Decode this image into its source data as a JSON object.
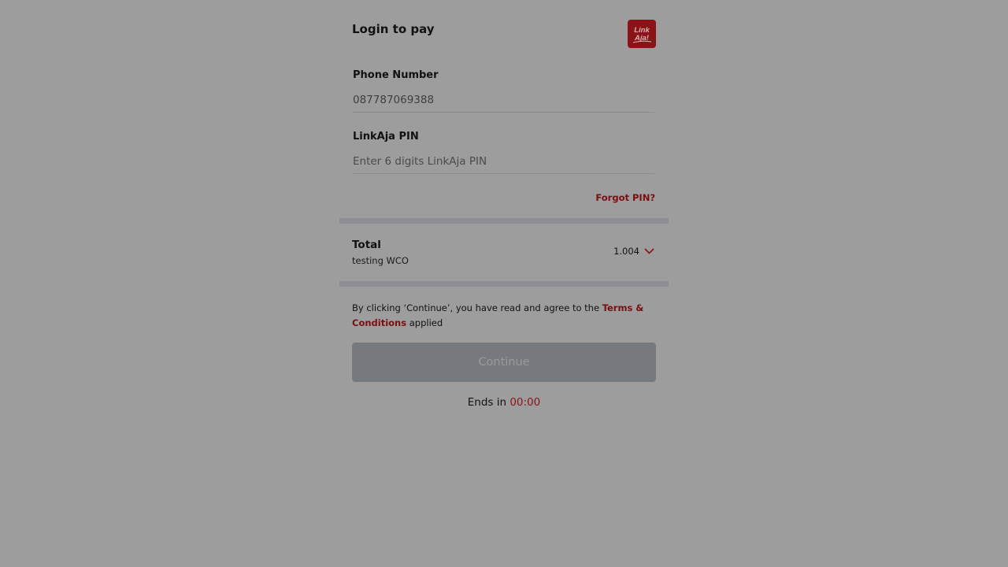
{
  "header": {
    "title": "Login to pay",
    "logo_text": "LinkAja!",
    "brand_color": "#8b1216"
  },
  "phone": {
    "label": "Phone Number",
    "value": "087787069388"
  },
  "pin": {
    "label": "LinkAja PIN",
    "placeholder": "Enter 6 digits LinkAja PIN",
    "forgot_label": "Forgot PIN?"
  },
  "total": {
    "label": "Total",
    "description": "testing WCO",
    "amount": "1.004",
    "expand_icon": "chevron-down-icon"
  },
  "terms": {
    "prefix": "By clicking ‘Continue’, you have read and agree to the ",
    "link_label": "Terms & Conditions",
    "suffix": " applied"
  },
  "continue_button": {
    "label": "Continue",
    "disabled": true
  },
  "countdown": {
    "prefix": "Ends in ",
    "time": "00:00"
  }
}
